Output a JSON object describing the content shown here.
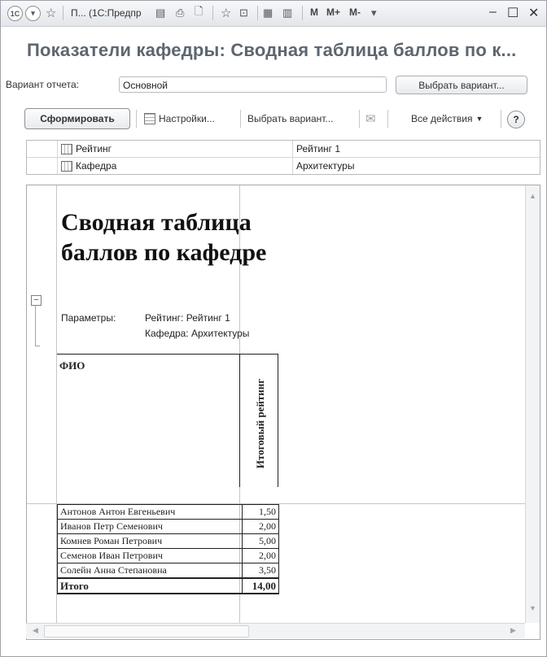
{
  "window": {
    "title": "П... (1С:Предпр",
    "logo": "1С",
    "memory_buttons": [
      "M",
      "M+",
      "M-"
    ]
  },
  "form": {
    "heading": "Показатели кафедры: Сводная таблица баллов по к...",
    "variant_label": "Вариант отчета:",
    "variant_value": "Основной",
    "select_variant_button": "Выбрать вариант..."
  },
  "toolbar": {
    "generate": "Сформировать",
    "settings": "Настройки...",
    "select_variant": "Выбрать вариант...",
    "all_actions": "Все действия",
    "help": "?"
  },
  "parameters": [
    {
      "name": "Рейтинг",
      "value": "Рейтинг 1"
    },
    {
      "name": "Кафедра",
      "value": "Архитектуры"
    }
  ],
  "report": {
    "title": "Сводная таблица баллов по кафедре",
    "params_label": "Параметры:",
    "param_lines": [
      "Рейтинг: Рейтинг 1",
      "Кафедра: Архитектуры"
    ],
    "col_name_header": "ФИО",
    "col_value_header": "Итоговый рейтинг",
    "rows": [
      {
        "name": "Антонов Антон Евгеньевич",
        "value": "1,50"
      },
      {
        "name": "Иванов Петр Семенович",
        "value": "2,00"
      },
      {
        "name": "Комнев Роман Петрович",
        "value": "5,00"
      },
      {
        "name": "Семенов Иван Петрович",
        "value": "2,00"
      },
      {
        "name": "Солейн Анна Степановна",
        "value": "3,50"
      }
    ],
    "total": {
      "name": "Итого",
      "value": "14,00"
    }
  }
}
